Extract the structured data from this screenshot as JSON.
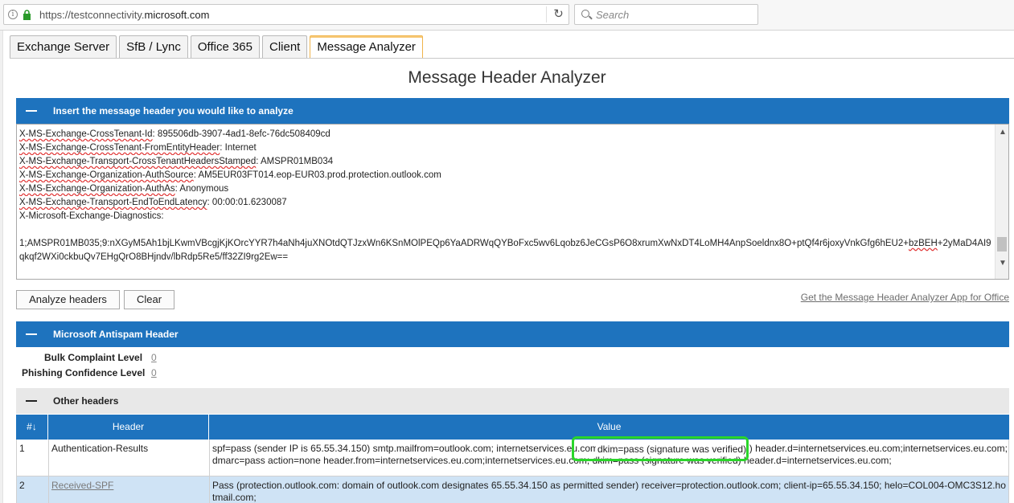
{
  "browser": {
    "url_prefix": "https://testconnectivity.",
    "url_domain": "microsoft.com",
    "search_placeholder": "Search"
  },
  "tabs": [
    {
      "label": "Exchange Server",
      "active": false
    },
    {
      "label": "SfB / Lync",
      "active": false
    },
    {
      "label": "Office 365",
      "active": false
    },
    {
      "label": "Client",
      "active": false
    },
    {
      "label": "Message Analyzer",
      "active": true
    }
  ],
  "page_title": "Message Header Analyzer",
  "insert_section": {
    "title": "Insert the message header you would like to analyze",
    "lines": [
      {
        "key": "X-MS-Exchange-CrossTenant-Id",
        "value": ": 895506db-3907-4ad1-8efc-76dc508409cd"
      },
      {
        "key": "X-MS-Exchange-CrossTenant-FromEntityHeader",
        "value": ": Internet"
      },
      {
        "key": "X-MS-Exchange-Transport-CrossTenantHeadersStamped",
        "value": ": AMSPR01MB034"
      },
      {
        "key": "X-MS-Exchange-Organization-AuthSource",
        "value": ": AM5EUR03FT014.eop-EUR03.prod.protection.outlook.com"
      },
      {
        "key": "X-MS-Exchange-Organization-AuthAs",
        "value": ": Anonymous"
      },
      {
        "key": "X-MS-Exchange-Transport-EndToEndLatency",
        "value": ": 00:00:01.6230087"
      }
    ],
    "diag_line": "X-Microsoft-Exchange-Diagnostics:",
    "blob_a": "1;AMSPR01MB035;9:nXGyM5Ah1bjLKwmVBcgjKjKOrcYYR7h4aNh4juXNOtdQTJzxWn6KSnMOlPEQp6YaADRWqQYBoFxc5wv6Lqobz6JeCGsP6O8xrumXwNxDT4LoMH4AnpSoeldnx8O+ptQf4r6joxyVnkGfg6hEU2+",
    "blob_b": "bzBEH",
    "blob_c": "+2yMaD4AI9qkqf2WXi0ckbuQv7EHgQrO8BHjndv/lbRdp5Re5/ff32ZI9rg2Ew=="
  },
  "buttons": {
    "analyze": "Analyze headers",
    "clear": "Clear",
    "app_link": "Get the Message Header Analyzer App for Office"
  },
  "antispam": {
    "title": "Microsoft Antispam Header",
    "bulk_label": "Bulk Complaint Level",
    "bulk_value": "0",
    "phish_label": "Phishing Confidence Level",
    "phish_value": "0"
  },
  "other_headers": {
    "title": "Other headers",
    "columns": [
      "#↓",
      "Header",
      "Value"
    ],
    "rows": [
      {
        "num": "1",
        "header": "Authentication-Results",
        "value_line1": "spf=pass (sender IP is 65.55.34.150) smtp.mailfrom=outlook.com; internetservices.eu.com; dkim=pass (signature was verified) header.d=internetservices.eu.com;internetservices.eu.com;",
        "value_line2": "dmarc=pass action=none header.from=internetservices.eu.com;internetservices.eu.com; dkim=pass (signature was verified) header.d=internetservices.eu.com;",
        "highlight": "dkim=pass (signature was verified)"
      },
      {
        "num": "2",
        "header": "Received-SPF",
        "value_line1": "Pass (protection.outlook.com: domain of outlook.com designates 65.55.34.150 as permitted sender) receiver=protection.outlook.com; client-ip=65.55.34.150; helo=COL004-OMC3S12.ho",
        "value_line2": "tmail.com;"
      }
    ]
  },
  "colors": {
    "accent_blue": "#1e73be",
    "highlight_green": "#2ad62a",
    "selected_row": "#cfe3f5"
  }
}
